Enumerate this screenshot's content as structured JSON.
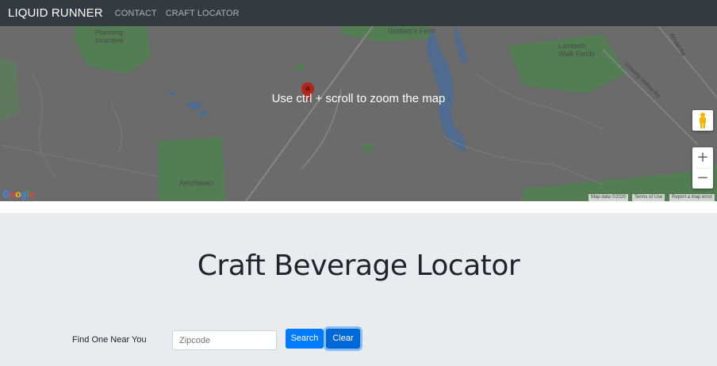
{
  "navbar": {
    "brand": "LIQUID RUNNER",
    "links": [
      "CONTACT",
      "CRAFT LOCATOR"
    ]
  },
  "map": {
    "overlay_message": "Use ctrl + scroll to zoom the map",
    "labels": [
      "Planning Incentive",
      "Gottlieb's Field",
      "Lambeth Walk Fields",
      "Aerohaven"
    ],
    "road_labels": [
      "Gravelly Hollow Rd",
      "Arnold Rd"
    ],
    "attribution": [
      "Map data ©2020",
      "Terms of Use",
      "Report a map error"
    ],
    "logo": "Google",
    "zoom_in": "+",
    "zoom_out": "−",
    "colors": {
      "land": "#7a7a7a",
      "park": "#5f8f5f",
      "water": "#5b7aa3",
      "road": "#9a9a9a"
    }
  },
  "locator": {
    "title": "Craft Beverage Locator",
    "find_label": "Find One Near You",
    "zip_placeholder": "Zipcode",
    "zip_value": "",
    "search_label": "Search",
    "clear_label": "Clear"
  }
}
